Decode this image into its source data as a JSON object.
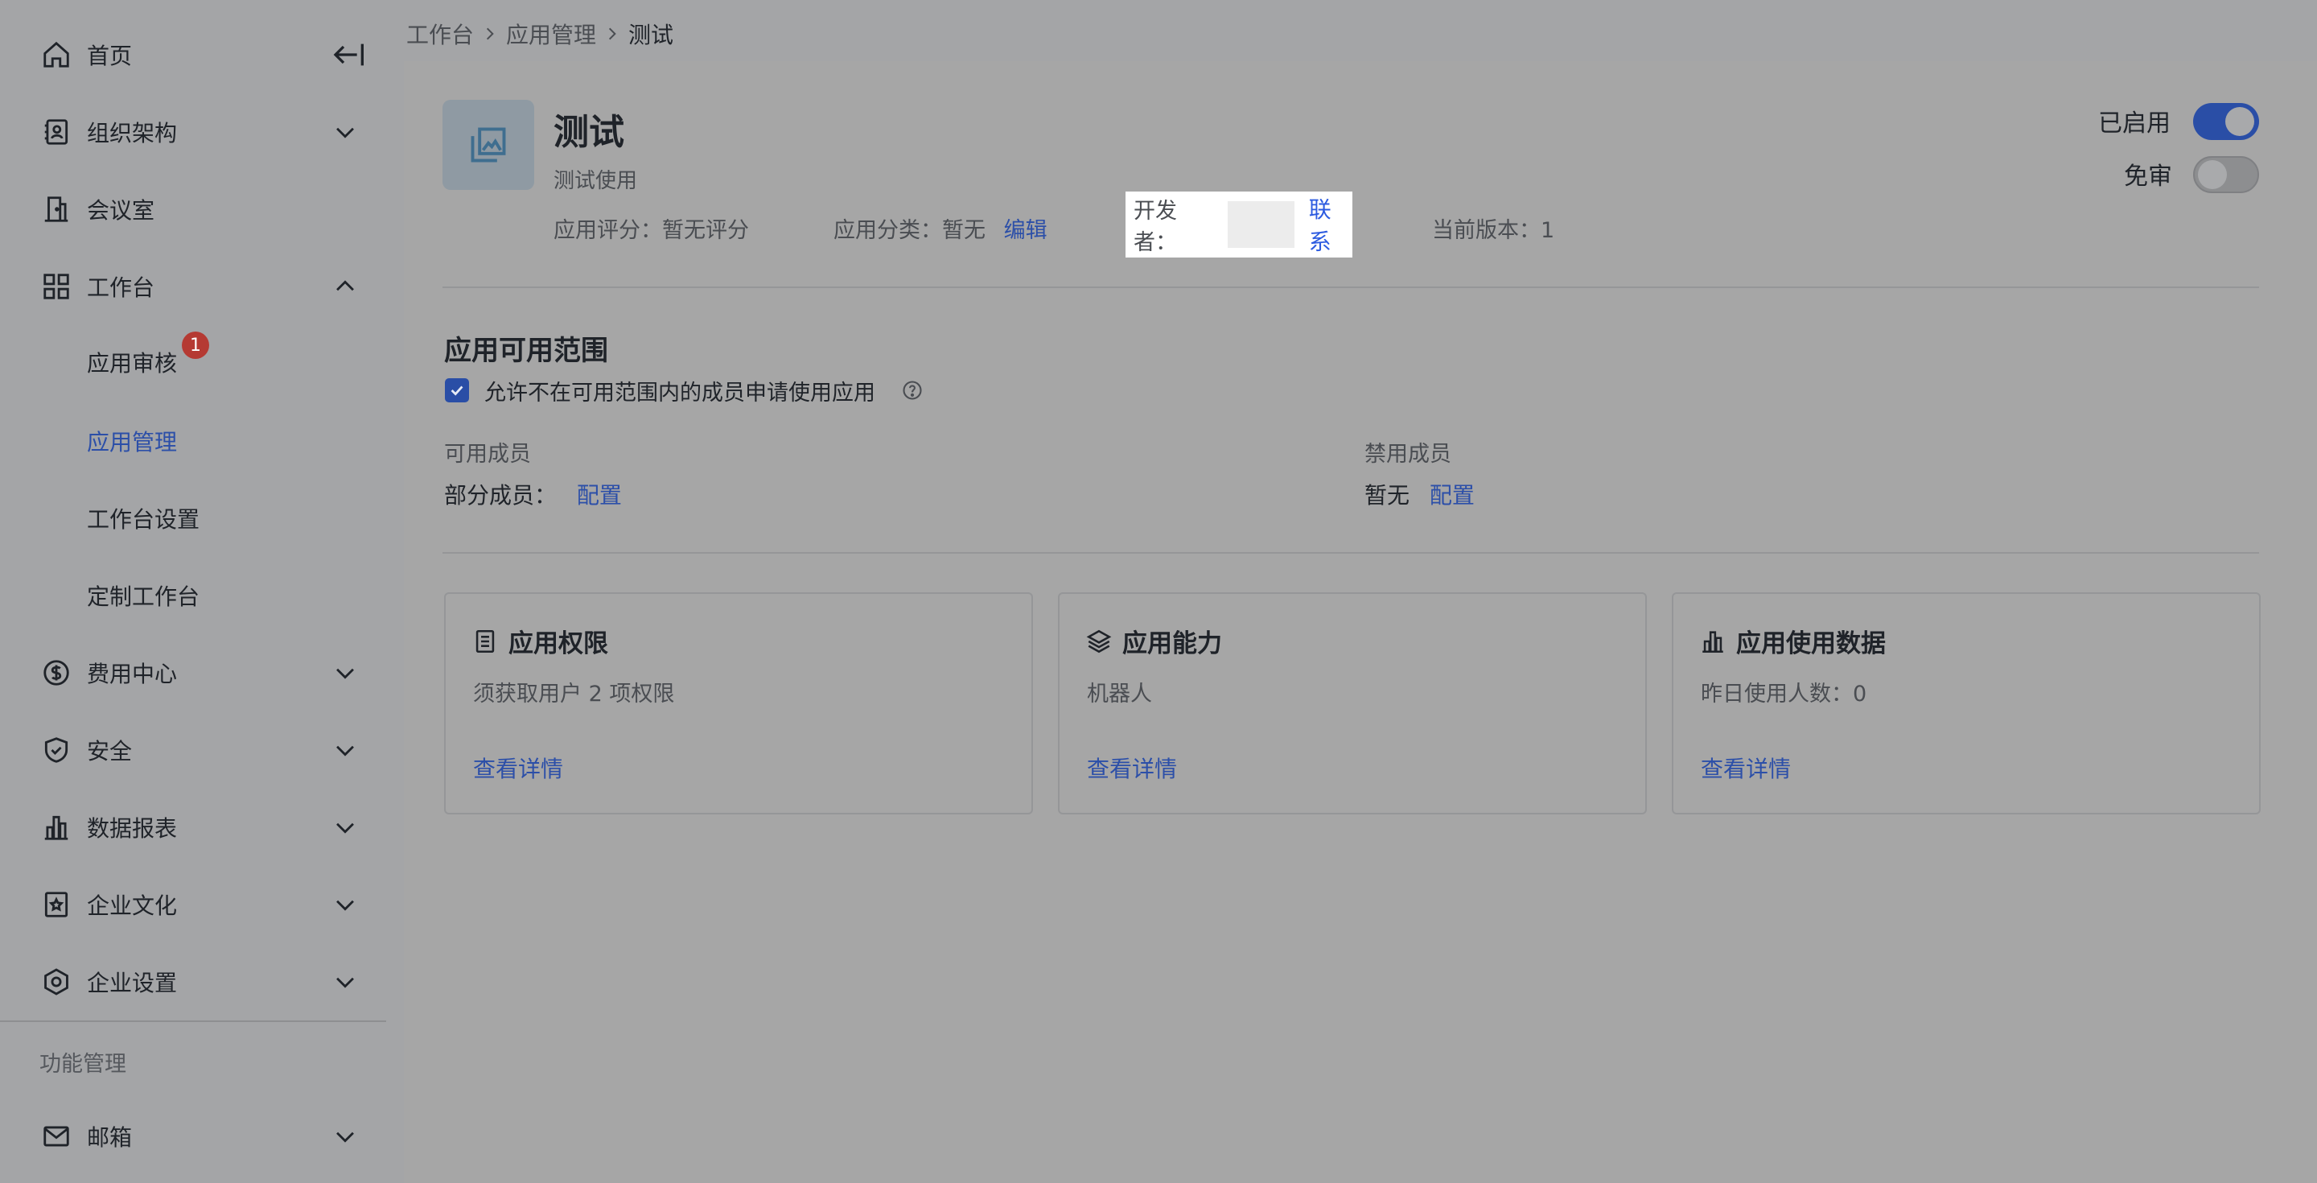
{
  "sidebar": {
    "items": [
      {
        "label": "首页",
        "icon": "home-icon"
      },
      {
        "label": "组织架构",
        "icon": "contacts-icon"
      },
      {
        "label": "会议室",
        "icon": "door-icon"
      },
      {
        "label": "工作台",
        "icon": "grid-icon"
      },
      {
        "label": "费用中心",
        "icon": "dollar-icon"
      },
      {
        "label": "安全",
        "icon": "shield-icon"
      },
      {
        "label": "数据报表",
        "icon": "bar-chart-icon"
      },
      {
        "label": "企业文化",
        "icon": "culture-icon"
      },
      {
        "label": "企业设置",
        "icon": "settings-icon"
      },
      {
        "label": "邮箱",
        "icon": "mail-icon"
      }
    ],
    "workbench_sub": [
      {
        "label": "应用审核",
        "badge": "1"
      },
      {
        "label": "应用管理",
        "active": true
      },
      {
        "label": "工作台设置"
      },
      {
        "label": "定制工作台"
      }
    ],
    "section_title": "功能管理"
  },
  "breadcrumb": [
    "工作台",
    "应用管理",
    "测试"
  ],
  "app": {
    "name": "测试",
    "description": "测试使用",
    "rating": "应用评分：暂无评分",
    "category_label": "应用分类：暂无",
    "category_edit": "编辑",
    "developer_label": "开发者：",
    "developer_contact": "联系",
    "version": "当前版本：1"
  },
  "toggles": {
    "enabled_label": "已启用",
    "enabled": true,
    "exempt_label": "免审",
    "exempt": false
  },
  "scope": {
    "title": "应用可用范围",
    "allow_apply_label": "允许不在可用范围内的成员申请使用应用",
    "allow_apply_checked": true,
    "available_label": "可用成员",
    "available_value": "部分成员：",
    "available_config": "配置",
    "banned_label": "禁用成员",
    "banned_value": "暂无",
    "banned_config": "配置"
  },
  "cards": [
    {
      "title": "应用权限",
      "icon": "list-doc-icon",
      "desc": "须获取用户 2 项权限",
      "link": "查看详情"
    },
    {
      "title": "应用能力",
      "icon": "layers-icon",
      "desc": "机器人",
      "link": "查看详情"
    },
    {
      "title": "应用使用数据",
      "icon": "bar-chart-icon",
      "desc": "昨日使用人数：0",
      "link": "查看详情"
    }
  ],
  "colors": {
    "accent": "#2c4fa8",
    "badge": "#b53a33",
    "overlay_bg": "#a6a6a6"
  }
}
